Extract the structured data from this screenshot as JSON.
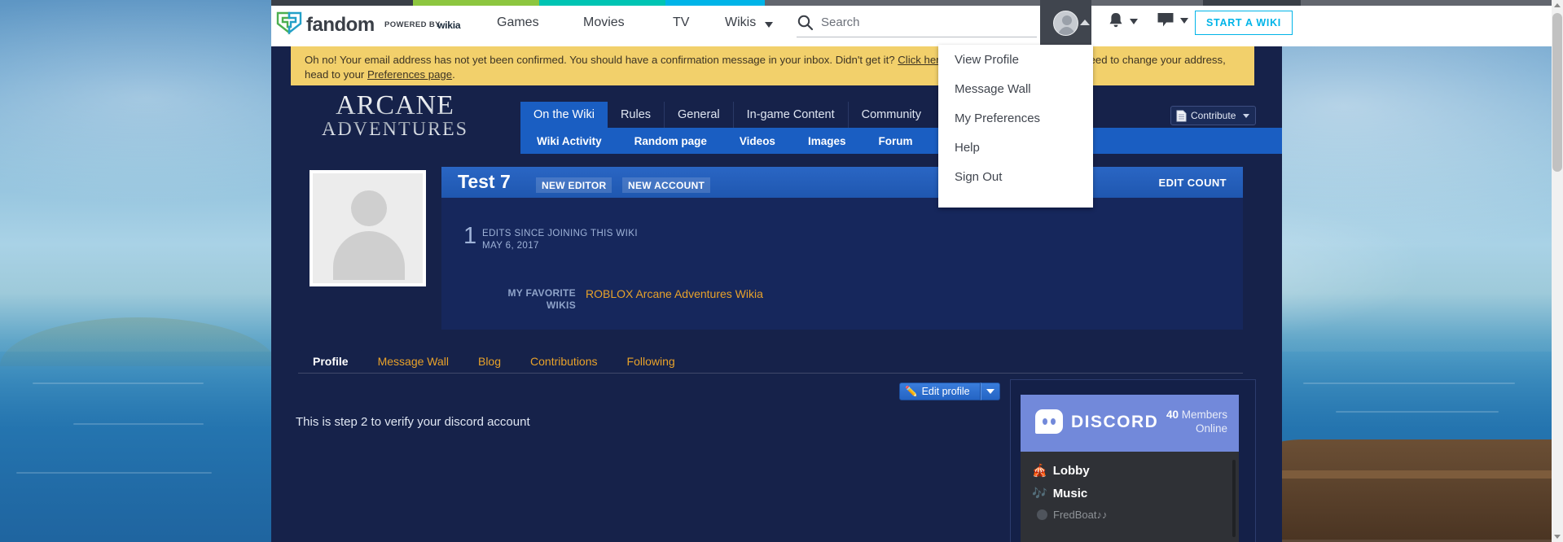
{
  "colorbar": {
    "segments": [
      "#3a3f47",
      "#8dc63f",
      "#00c4b3",
      "#00b4e8",
      "#62666e",
      "#3a3f47",
      "#62666e"
    ]
  },
  "global_nav": {
    "logo_word": "fandom",
    "powered_by": "POWERED BY",
    "powered_brand": "wikia",
    "links": [
      {
        "label": "Games"
      },
      {
        "label": "Movies"
      },
      {
        "label": "TV"
      },
      {
        "label": "Wikis"
      }
    ],
    "search_placeholder": "Search",
    "search_value": "",
    "start_wiki_label": "START A WIKI"
  },
  "user_dropdown": {
    "items": [
      {
        "label": "View Profile"
      },
      {
        "label": "Message Wall"
      },
      {
        "label": "My Preferences"
      },
      {
        "label": "Help"
      },
      {
        "label": "Sign Out"
      }
    ]
  },
  "email_banner": {
    "text_1": "Oh no! Your email address has not yet been confirmed. You should have a confirmation message in your inbox. Didn't get it? ",
    "link_1": "Click here",
    "text_2": " to send a new one, or if you need to change your address, head to your ",
    "link_2": "Preferences page",
    "text_3": "."
  },
  "wiki": {
    "logo_line1": "ARCANE",
    "logo_line2": "ADVENTURES",
    "nav_tabs": [
      {
        "label": "On the Wiki",
        "active": true
      },
      {
        "label": "Rules",
        "active": false
      },
      {
        "label": "General",
        "active": false
      },
      {
        "label": "In-game Content",
        "active": false
      },
      {
        "label": "Community",
        "active": false
      }
    ],
    "sub_nav": [
      {
        "label": "Wiki Activity"
      },
      {
        "label": "Random page"
      },
      {
        "label": "Videos"
      },
      {
        "label": "Images"
      },
      {
        "label": "Forum"
      }
    ],
    "contribute_label": "Contribute"
  },
  "profile": {
    "username": "Test 7",
    "tags": [
      "NEW EDITOR",
      "NEW ACCOUNT"
    ],
    "edit_count_label": "EDIT COUNT",
    "edits_number": "1",
    "edits_caption": "EDITS SINCE JOINING THIS WIKI",
    "join_date": "MAY 6, 2017",
    "fav_wikis_label": "MY FAVORITE WIKIS",
    "fav_wiki_link": "ROBLOX Arcane Adventures Wikia",
    "tabs": [
      {
        "label": "Profile",
        "active": true
      },
      {
        "label": "Message Wall",
        "active": false
      },
      {
        "label": "Blog",
        "active": false
      },
      {
        "label": "Contributions",
        "active": false
      },
      {
        "label": "Following",
        "active": false
      }
    ],
    "edit_profile_label": "Edit profile",
    "bio": "This is step 2 to verify your discord account"
  },
  "discord": {
    "title": "DISCORD",
    "members_count": "40",
    "members_label": "Members",
    "online_label": "Online",
    "channels": [
      {
        "emoji": "🎪",
        "name": "Lobby"
      },
      {
        "emoji": "🎶",
        "name": "Music"
      }
    ],
    "members": [
      {
        "name": "FredBoat♪♪"
      }
    ]
  }
}
